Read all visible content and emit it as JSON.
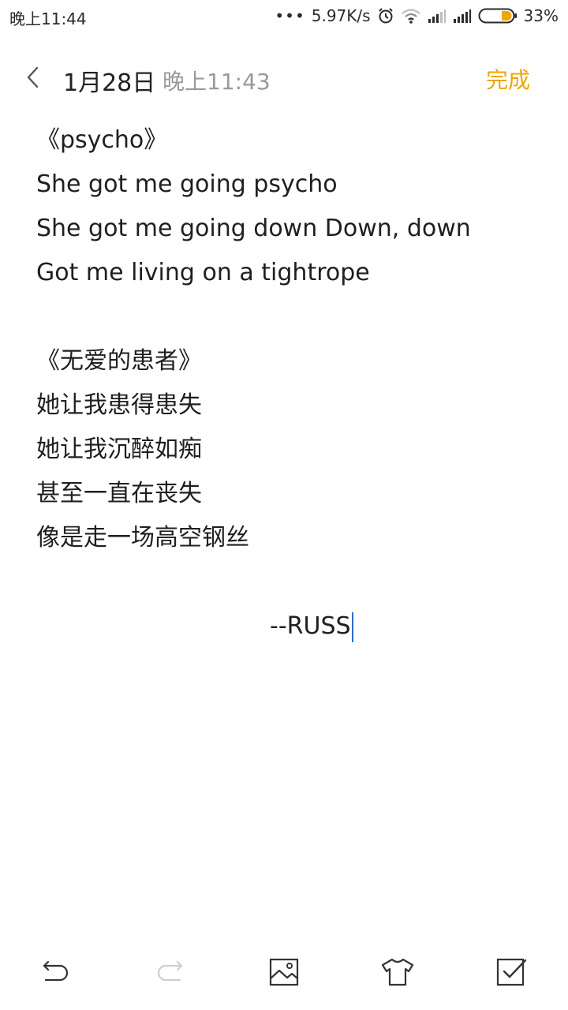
{
  "status_bar": {
    "time": "晚上11:44",
    "dots": "•••",
    "network_speed": "5.97K/s",
    "battery_percent": "33%",
    "icons": [
      "alarm-icon",
      "wifi-icon",
      "signal-icon",
      "signal-icon",
      "battery-icon"
    ],
    "battery_color": "#f0a500"
  },
  "header": {
    "date": "1月28日",
    "time": "晚上11:43",
    "done_label": "完成",
    "accent_color": "#f0a500",
    "back_icon": "chevron-left-icon"
  },
  "note": {
    "lines": [
      "《psycho》",
      "She got me going psycho",
      "She got me going down Down, down",
      "Got me living on a tightrope",
      "",
      "《无爱的患者》",
      "她让我患得患失",
      "她让我沉醉如痴",
      "甚至一直在丧失",
      "像是走一场高空钢丝",
      ""
    ],
    "signature": "--RUSS"
  },
  "toolbar": {
    "icons": [
      "undo-icon",
      "redo-icon",
      "image-icon",
      "theme-shirt-icon",
      "checklist-icon"
    ]
  }
}
